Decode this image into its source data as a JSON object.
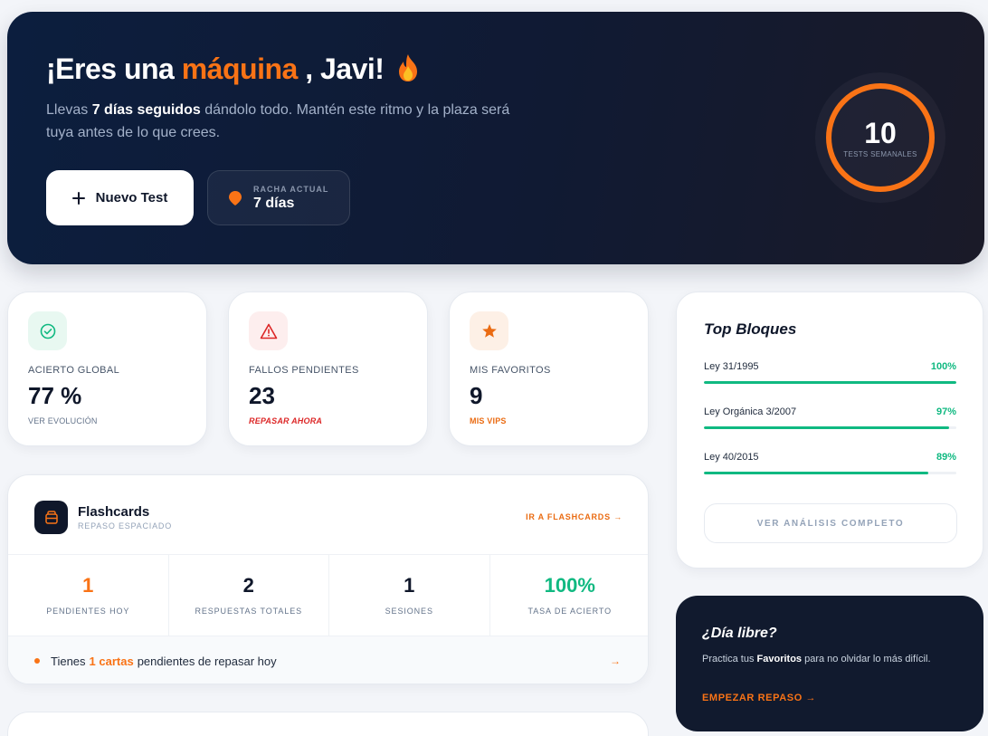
{
  "hero": {
    "title_prefix": "¡Eres una ",
    "title_accent": "máquina",
    "title_suffix": " , Javi!",
    "subtitle_pre": "Llevas ",
    "subtitle_bold": "7 días seguidos",
    "subtitle_post": " dándolo todo. Mantén este ritmo y la plaza será tuya antes de lo que crees.",
    "new_test_label": "Nuevo Test",
    "streak_label": "RACHA ACTUAL",
    "streak_value": "7 días",
    "ring_value": "10",
    "ring_label": "TESTS SEMANALES",
    "accent_color": "#f97316"
  },
  "stats": [
    {
      "label": "ACIERTO GLOBAL",
      "value": "77 %",
      "link": "VER EVOLUCIÓN",
      "icon": "check-circle-icon",
      "color": "#10b981"
    },
    {
      "label": "FALLOS PENDIENTES",
      "value": "23",
      "link": "REPASAR AHORA",
      "icon": "warning-icon",
      "color": "#dc2626"
    },
    {
      "label": "MIS FAVORITOS",
      "value": "9",
      "link": "MIS VIPS",
      "icon": "star-icon",
      "color": "#f97316"
    }
  ],
  "top_bloques": {
    "title": "Top Bloques",
    "items": [
      {
        "name": "Ley 31/1995",
        "pct_label": "100%",
        "pct": 100
      },
      {
        "name": "Ley Orgánica 3/2007",
        "pct_label": "97%",
        "pct": 97
      },
      {
        "name": "Ley 40/2015",
        "pct_label": "89%",
        "pct": 89
      }
    ],
    "button_label": "VER ANÁLISIS COMPLETO"
  },
  "flashcards": {
    "title": "Flashcards",
    "subtitle": "REPASO ESPACIADO",
    "link": "IR A FLASHCARDS →",
    "stats": [
      {
        "value": "1",
        "label": "PENDIENTES HOY",
        "color": "#f97316"
      },
      {
        "value": "2",
        "label": "RESPUESTAS TOTALES",
        "color": "#0f172a"
      },
      {
        "value": "1",
        "label": "SESIONES",
        "color": "#0f172a"
      },
      {
        "value": "100%",
        "label": "TASA DE ACIERTO",
        "color": "#10b981"
      }
    ],
    "footer_pre": "Tienes",
    "footer_highlight": "1 cartas",
    "footer_post": "pendientes de repasar hoy",
    "footer_arrow": "→"
  },
  "dia_libre": {
    "title": "¿Día libre?",
    "text_pre": "Practica tus ",
    "text_bold": "Favoritos",
    "text_post": " para no olvidar lo más difícil.",
    "link": "EMPEZAR REPASO →"
  }
}
